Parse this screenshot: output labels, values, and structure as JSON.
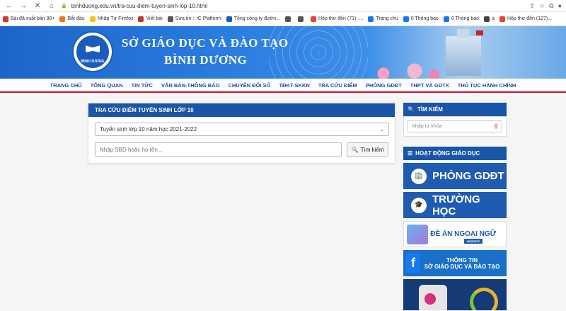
{
  "browser": {
    "url": "binhduong.edu.vn/tra-cuu-diem-tuyen-sinh-lop-10.html",
    "bookmarks": [
      {
        "label": "Bài đã xuất bản 99+",
        "color": "#d9342b"
      },
      {
        "label": "Bắt đầu",
        "color": "#e87722"
      },
      {
        "label": "Nhập Từ Firefox",
        "color": "#f0c419"
      },
      {
        "label": "Viết bài",
        "color": "#c0392b"
      },
      {
        "label": "Sửa tin :: iC Platform",
        "color": "#555555"
      },
      {
        "label": "Tổng công ty đườn...",
        "color": "#1f5bb0"
      },
      {
        "label": "",
        "color": "#555555"
      },
      {
        "label": "",
        "color": "#555555"
      },
      {
        "label": "Hộp thư đến (71) -...",
        "color": "#ea4335"
      },
      {
        "label": "Trang chủ",
        "color": "#1877f2"
      },
      {
        "label": "0 Thông báo",
        "color": "#1877f2"
      },
      {
        "label": "0 Thông báo",
        "color": "#1877f2"
      },
      {
        "label": "a",
        "color": "#444444"
      },
      {
        "label": "Hộp thư đến (127)...",
        "color": "#ea4335"
      }
    ]
  },
  "header": {
    "title_line1": "SỞ GIÁO DỤC VÀ ĐÀO TẠO",
    "title_line2": "BÌNH DƯƠNG",
    "logo_text": "BÌNH DƯƠNG"
  },
  "menu": [
    "TRANG CHỦ",
    "TỔNG QUAN",
    "TIN TỨC",
    "VĂN BẢN-THÔNG BÁO",
    "CHUYỂN ĐỔI SỐ",
    "TĐKT-SKKN",
    "TRA CỨU ĐIỂM",
    "PHÒNG GDĐT",
    "THPT VÀ GDTX",
    "THỦ TỤC HÀNH CHÍNH"
  ],
  "lookup": {
    "heading": "TRA CỨU ĐIỂM TUYỂN SINH LỚP 10",
    "exam_selected": "Tuyển sinh lớp 10 năm học 2021-2022",
    "input_placeholder": "Nhập SBD hoặc họ tên...",
    "search_button": "Tìm kiếm"
  },
  "sidebar": {
    "search_heading": "TÌM KIẾM",
    "search_placeholder": "Nhập từ khóa",
    "activities_heading": "HOẠT ĐỘNG GIÁO DỤC",
    "banners": {
      "phong": "PHÒNG GDĐT",
      "truong": "TRƯỜNG HỌC",
      "ngoaingu": "ĐỀ ÁN NGOẠI NGỮ",
      "ngoaingu_sub": "WEBSITE",
      "thongtin1": "THÔNG TIN",
      "thongtin2": "SỞ GIÁO DỤC VÀ ĐÀO TẠO"
    }
  }
}
